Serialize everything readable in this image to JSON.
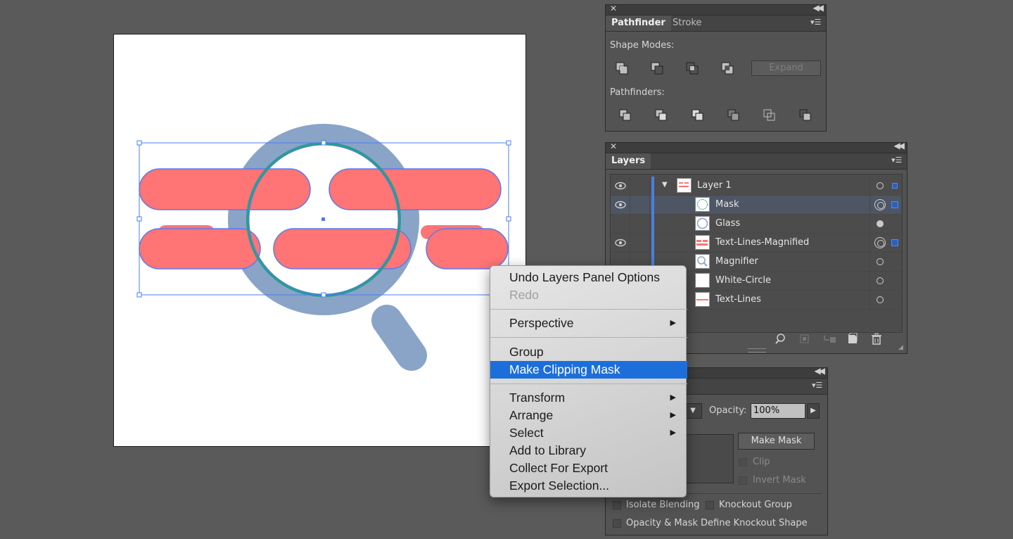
{
  "pathfinder_panel": {
    "tabs": [
      {
        "label": "Pathfinder"
      },
      {
        "label": "Stroke"
      }
    ],
    "shape_modes_label": "Shape Modes:",
    "expand_label": "Expand",
    "pathfinders_label": "Pathfinders:"
  },
  "layers_panel": {
    "tab_label": "Layers",
    "rows": [
      {
        "name": "Layer 1"
      },
      {
        "name": "Mask"
      },
      {
        "name": "Glass"
      },
      {
        "name": "Text-Lines-Magnified"
      },
      {
        "name": "Magnifier"
      },
      {
        "name": "White-Circle"
      },
      {
        "name": "Text-Lines"
      }
    ]
  },
  "transparency_panel": {
    "opacity_label": "Opacity:",
    "opacity_value": "100%",
    "make_mask_label": "Make Mask",
    "clip_label": "Clip",
    "invert_mask_label": "Invert Mask",
    "isolate_blending_label": "Isolate Blending",
    "knockout_group_label": "Knockout Group",
    "opacity_mask_knockout_label": "Opacity & Mask Define Knockout Shape"
  },
  "context_menu": {
    "items": [
      {
        "label": "Undo Layers Panel Options"
      },
      {
        "label": "Redo"
      },
      {
        "label": "Perspective"
      },
      {
        "label": "Group"
      },
      {
        "label": "Make Clipping Mask"
      },
      {
        "label": "Transform"
      },
      {
        "label": "Arrange"
      },
      {
        "label": "Select"
      },
      {
        "label": "Add to Library"
      },
      {
        "label": "Collect For Export"
      },
      {
        "label": "Export Selection..."
      }
    ]
  },
  "colors": {
    "canvas_bg": "#5a5a5a",
    "pill": "#ff7474",
    "magnifier": "#8aa4c8",
    "mask_ring": "#2a9d8f",
    "selection": "#4a7cf0",
    "menu_highlight": "#1c6fdb"
  },
  "icons": {
    "eye": "eye-icon",
    "search": "search-icon",
    "trash": "trash-icon",
    "submenu": "chevron-right-icon"
  }
}
